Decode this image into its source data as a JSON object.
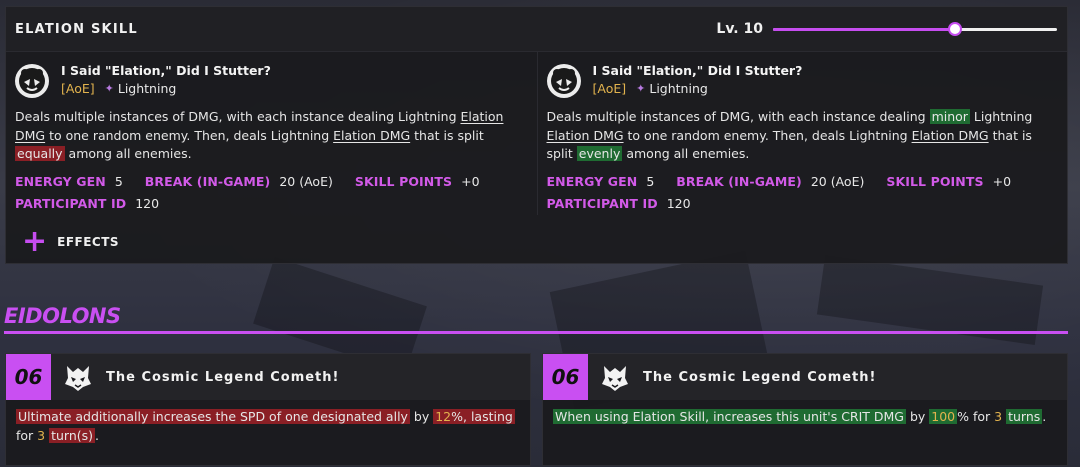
{
  "skill": {
    "title": "ELATION SKILL",
    "level_label": "Lv. 10",
    "level": 10,
    "level_fraction": 0.64,
    "left": {
      "name": "I Said \"Elation,\" Did I Stutter?",
      "target": "[AoE]",
      "element": "Lightning",
      "desc": {
        "p1": "Deals multiple instances of DMG, with each instance dealing Lightning ",
        "t1": "Elation DMG",
        "p2": " to one random enemy. Then, deals Lightning ",
        "t2": "Elation DMG",
        "p3": " that is split ",
        "hl": "equally",
        "p4": " among all enemies."
      }
    },
    "right": {
      "name": "I Said \"Elation,\" Did I Stutter?",
      "target": "[AoE]",
      "element": "Lightning",
      "desc": {
        "p0": "Deals multiple instances of DMG, with each instance dealing ",
        "hl1": "minor",
        "p1": " Lightning ",
        "t1": "Elation DMG",
        "p2": " to one random enemy. Then, deals Lightning ",
        "t2": "Elation DMG",
        "p3": " that is split ",
        "hl2": "evenly",
        "p4": " among all enemies."
      }
    },
    "stats": {
      "energy_gen_label": "ENERGY GEN",
      "energy_gen": "5",
      "break_label": "BREAK (IN-GAME)",
      "break": "20 (AoE)",
      "skill_points_label": "SKILL POINTS",
      "skill_points": "+0",
      "participant_label": "PARTICIPANT ID",
      "participant": "120"
    },
    "effects_label": "EFFECTS"
  },
  "eidolons": {
    "title": "EIDOLONS",
    "left": {
      "number": "06",
      "name": "The Cosmic Legend Cometh!",
      "hl1": "Ultimate additionally increases the SPD of one designated ally",
      "p1": " by ",
      "n1": "12",
      "hl2a": "%",
      "hl2b": ", lasting",
      "p2": " for ",
      "n2": "3",
      "p3": " ",
      "hl3": "turn(s)",
      "p4": "."
    },
    "right": {
      "number": "06",
      "name": "The Cosmic Legend Cometh!",
      "hl1": "When using Elation Skill, increases this unit's CRIT DMG",
      "p1": " by ",
      "n1": "100",
      "p2": "% for ",
      "n2": "3",
      "p3": " ",
      "hl2": "turns",
      "p4": "."
    }
  },
  "colors": {
    "accent": "#c94ff2",
    "gold": "#e2b34e",
    "highlight_red": "#8a1f25",
    "highlight_green": "#1f6b32"
  },
  "icons": {
    "skill_icon": "bear-mascot-icon",
    "element_icon": "lightning-icon",
    "eidolon_icon": "wolf-emblem-icon",
    "effects_icon": "plus-icon"
  }
}
